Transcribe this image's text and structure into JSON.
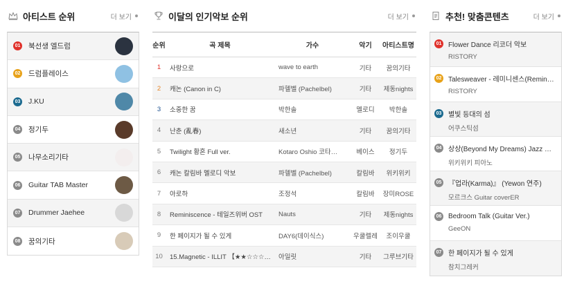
{
  "colors": {
    "rank_red": "#e0322b",
    "rank_yellow": "#e8a21a",
    "rank_blue": "#1b6a8f",
    "rank_gray": "#8a8a8a",
    "rank_num_red": "#e0322b",
    "rank_num_orange": "#e6862a",
    "rank_num_blue": "#1b4f8f"
  },
  "artists": {
    "title": "아티스트 순위",
    "more": "더 보기",
    "title_icon": "crown-icon",
    "items": [
      {
        "rank": "01",
        "name": "북선생 엘드럼",
        "badge_color": "#e0322b",
        "avatar_color": "#2b3340"
      },
      {
        "rank": "02",
        "name": "드럼플레이스",
        "badge_color": "#e8a21a",
        "avatar_color": "#8fc1e3"
      },
      {
        "rank": "03",
        "name": "J.KU",
        "badge_color": "#1b6a8f",
        "avatar_color": "#4f88a8"
      },
      {
        "rank": "04",
        "name": "정기두",
        "badge_color": "#8a8a8a",
        "avatar_color": "#5a3b2a"
      },
      {
        "rank": "05",
        "name": "나무소리기타",
        "badge_color": "#8a8a8a",
        "avatar_color": "#f3eeee"
      },
      {
        "rank": "06",
        "name": "Guitar TAB Master",
        "badge_color": "#8a8a8a",
        "avatar_color": "#6d5a45"
      },
      {
        "rank": "07",
        "name": "Drummer Jaehee",
        "badge_color": "#8a8a8a",
        "avatar_color": "#d8d8d8"
      },
      {
        "rank": "08",
        "name": "꿈의기타",
        "badge_color": "#8a8a8a",
        "avatar_color": "#d8cbb8"
      }
    ]
  },
  "chart": {
    "title": "이달의 인기악보 순위",
    "more": "더 보기",
    "title_icon": "trophy-icon",
    "headers": {
      "rank": "순위",
      "title": "곡 제목",
      "singer": "가수",
      "instrument": "악기",
      "artist": "아티스트명"
    },
    "rows": [
      {
        "rank": "1",
        "rank_color": "#e0322b",
        "title": "사랑으로",
        "singer": "wave to earth",
        "instrument": "기타",
        "artist": "꿈의기타"
      },
      {
        "rank": "2",
        "rank_color": "#e6862a",
        "title": "캐논 (Canon in C)",
        "singer": "파헬벨 (Pachelbel)",
        "instrument": "기타",
        "artist": "제동nights"
      },
      {
        "rank": "3",
        "rank_color": "#1b4f8f",
        "title": "소중한 꿈",
        "singer": "박한솔",
        "instrument": "멜로디",
        "artist": "박한솔"
      },
      {
        "rank": "4",
        "rank_color": "#777777",
        "title": "난춘 (亂春)",
        "singer": "새소년",
        "instrument": "기타",
        "artist": "꿈의기타"
      },
      {
        "rank": "5",
        "rank_color": "#777777",
        "title": "Twilight 황혼 Full ver.",
        "singer": "Kotaro Oshio 코타…",
        "instrument": "베이스",
        "artist": "정기두"
      },
      {
        "rank": "6",
        "rank_color": "#777777",
        "title": "캐논 칼림바 멜로디 악보",
        "singer": "파헬벨 (Pachelbel)",
        "instrument": "칼림바",
        "artist": "위키위키"
      },
      {
        "rank": "7",
        "rank_color": "#777777",
        "title": "아로하",
        "singer": "조정석",
        "instrument": "칼림바",
        "artist": "장미ROSE"
      },
      {
        "rank": "8",
        "rank_color": "#777777",
        "title": "Reminiscence - 테일즈위버 OST",
        "singer": "Nauts",
        "instrument": "기타",
        "artist": "제동nights"
      },
      {
        "rank": "9",
        "rank_color": "#777777",
        "title": "한 페이지가 될 수 있게",
        "singer": "DAY6(데이식스)",
        "instrument": "우쿨렐레",
        "artist": "조이우쿨"
      },
      {
        "rank": "10",
        "rank_color": "#777777",
        "title": "15.Magnetic - ILLIT 【★★☆☆☆…",
        "singer": "아일릿",
        "instrument": "기타",
        "artist": "그루브기타"
      }
    ]
  },
  "recommend": {
    "title": "추천! 맞춤콘텐츠",
    "more": "더 보기",
    "title_icon": "document-icon",
    "items": [
      {
        "rank": "01",
        "badge_color": "#e0322b",
        "title": "Flower Dance 리코더 악보",
        "sub": "RISTORY"
      },
      {
        "rank": "02",
        "badge_color": "#e8a21a",
        "title": "Talesweaver - 레미니센스(Reminisce…",
        "sub": "RISTORY"
      },
      {
        "rank": "03",
        "badge_color": "#1b6a8f",
        "title": "별빛 등대의 섬",
        "sub": "어쿠스틱섬"
      },
      {
        "rank": "04",
        "badge_color": "#8a8a8a",
        "title": "상상(Beyond My Dreams) Jazz VER.",
        "sub": "위키위키 피아노"
      },
      {
        "rank": "05",
        "badge_color": "#8a8a8a",
        "title": "『업라(Karma)』 (Yewon 연주)",
        "sub": "모르크스 Guitar coverER"
      },
      {
        "rank": "06",
        "badge_color": "#8a8a8a",
        "title": "Bedroom Talk (Guitar Ver.)",
        "sub": "GeeON"
      },
      {
        "rank": "07",
        "badge_color": "#8a8a8a",
        "title": "한 페이지가 될 수 있게",
        "sub": "참치그레커"
      }
    ]
  }
}
